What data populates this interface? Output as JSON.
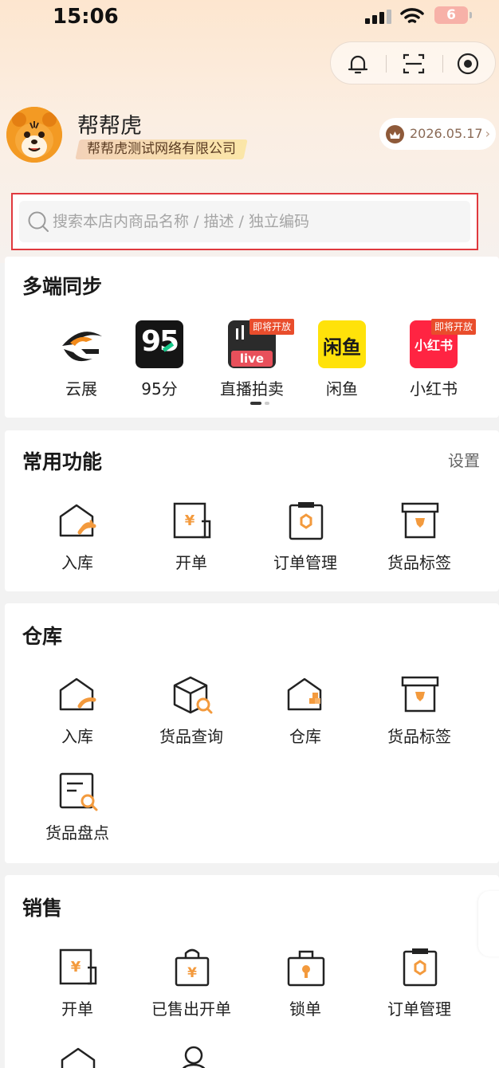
{
  "status_bar": {
    "time": "15:06",
    "battery": "6"
  },
  "profile": {
    "name": "帮帮虎",
    "company": "帮帮虎测试网络有限公司",
    "expiry": "2026.05.17",
    "expiry_chevron": "›"
  },
  "search": {
    "placeholder": "搜索本店内商品名称 / 描述 / 独立编码"
  },
  "sync": {
    "title": "多端同步",
    "items": [
      {
        "label": "云展",
        "icon": "yunzhan-logo",
        "badge": ""
      },
      {
        "label": "95分",
        "icon": "95fen-logo",
        "logo_text": "95",
        "badge": ""
      },
      {
        "label": "直播拍卖",
        "icon": "live-logo",
        "logo_text": "live",
        "badge": "即将开放"
      },
      {
        "label": "闲鱼",
        "icon": "xianyu-logo",
        "logo_text": "闲鱼",
        "badge": ""
      },
      {
        "label": "小红书",
        "icon": "xiaohongshu-logo",
        "logo_text": "小红书",
        "badge": "即将开放"
      }
    ]
  },
  "common": {
    "title": "常用功能",
    "action": "设置",
    "items": [
      {
        "label": "入库",
        "icon": "house-inbound-icon"
      },
      {
        "label": "开单",
        "icon": "yuan-bill-icon"
      },
      {
        "label": "订单管理",
        "icon": "clipboard-order-icon"
      },
      {
        "label": "货品标签",
        "icon": "box-label-icon"
      }
    ]
  },
  "warehouse": {
    "title": "仓库",
    "items": [
      {
        "label": "入库",
        "icon": "house-inbound-icon"
      },
      {
        "label": "货品查询",
        "icon": "box-search-icon"
      },
      {
        "label": "仓库",
        "icon": "warehouse-icon"
      },
      {
        "label": "货品标签",
        "icon": "box-label-icon"
      },
      {
        "label": "货品盘点",
        "icon": "inventory-count-icon"
      }
    ]
  },
  "sales": {
    "title": "销售",
    "items": [
      {
        "label": "开单",
        "icon": "yuan-bill-icon"
      },
      {
        "label": "已售出开单",
        "icon": "sold-bag-icon"
      },
      {
        "label": "锁单",
        "icon": "lock-bag-icon"
      },
      {
        "label": "订单管理",
        "icon": "clipboard-order-icon"
      }
    ]
  },
  "colors": {
    "accent": "#f39a3d",
    "search_border": "#e0393e",
    "badge": "#e94d2c"
  }
}
